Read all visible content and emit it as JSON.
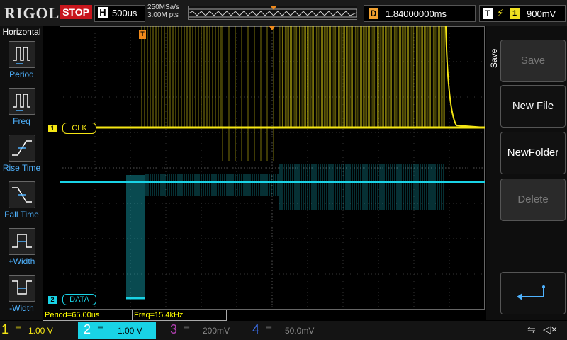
{
  "header": {
    "logo": "RIGOL",
    "run_state": "STOP",
    "timebase_letter": "H",
    "timebase_value": "500us",
    "sample_rate": "250MSa/s",
    "memory_depth": "3.00M pts",
    "delay_letter": "D",
    "delay_value": "1.84000000ms",
    "trigger_letter": "T",
    "trigger_source": "1",
    "trigger_level": "900mV"
  },
  "left_panel": {
    "title": "Horizontal",
    "items": [
      {
        "label": "Period",
        "icon": "period-icon"
      },
      {
        "label": "Freq",
        "icon": "frequency-icon"
      },
      {
        "label": "Rise Time",
        "icon": "rise-time-icon"
      },
      {
        "label": "Fall Time",
        "icon": "fall-time-icon"
      },
      {
        "label": "+Width",
        "icon": "positive-width-icon"
      },
      {
        "label": "-Width",
        "icon": "negative-width-icon"
      }
    ]
  },
  "channels_on_screen": {
    "ch1_label": "CLK",
    "ch2_label": "DATA",
    "ch1_marker": "1",
    "ch2_marker": "2",
    "trigger_marker": "T"
  },
  "right_panel": {
    "title": "Save",
    "buttons": [
      {
        "label": "Save",
        "enabled": false
      },
      {
        "label": "New File",
        "enabled": true
      },
      {
        "label": "NewFolder",
        "enabled": true
      },
      {
        "label": "Delete",
        "enabled": false
      }
    ]
  },
  "measurements": {
    "period": "Period=65.00us",
    "freq": "Freq=15.4kHz"
  },
  "bottom_bar": {
    "channels": [
      {
        "num": "1",
        "value": "1.00 V",
        "color": "#f5e614",
        "active": true
      },
      {
        "num": "2",
        "value": "1.00 V",
        "color": "#19d3e6",
        "active": true
      },
      {
        "num": "3",
        "value": "200mV",
        "color": "#b040b0",
        "active": false
      },
      {
        "num": "4",
        "value": "50.0mV",
        "color": "#3a6adf",
        "active": false
      }
    ]
  },
  "colors": {
    "ch1": "#f5e614",
    "ch2": "#19d3e6",
    "trigger": "#f08a1c",
    "stop": "#c8161d",
    "accent_blue": "#4fb3ff"
  }
}
